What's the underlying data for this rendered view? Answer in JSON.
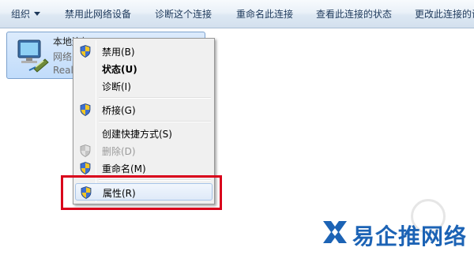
{
  "toolbar": {
    "items": [
      {
        "label": "组织"
      },
      {
        "label": "禁用此网络设备"
      },
      {
        "label": "诊断这个连接"
      },
      {
        "label": "重命名此连接"
      },
      {
        "label": "查看此连接的状态"
      },
      {
        "label": "更改此连接的设"
      }
    ]
  },
  "adapter": {
    "name": "本地连接",
    "status": "网络",
    "device": "Realtek",
    "icon": "network-adapter-icon"
  },
  "context_menu": {
    "items": [
      {
        "label": "禁用(B)",
        "icon": "shield-icon",
        "state": "normal"
      },
      {
        "label": "状态(U)",
        "icon": "",
        "state": "default"
      },
      {
        "label": "诊断(I)",
        "icon": "",
        "state": "normal"
      },
      {
        "label": "桥接(G)",
        "icon": "shield-icon",
        "state": "normal"
      },
      {
        "label": "创建快捷方式(S)",
        "icon": "",
        "state": "normal"
      },
      {
        "label": "删除(D)",
        "icon": "shield-icon",
        "state": "disabled"
      },
      {
        "label": "重命名(M)",
        "icon": "shield-icon",
        "state": "normal"
      },
      {
        "label": "属性(R)",
        "icon": "shield-icon",
        "state": "highlighted"
      }
    ]
  },
  "annotation": {
    "color": "#d9001b"
  },
  "watermark": {
    "brand": "易企推网络",
    "color": "#1c63b5"
  }
}
